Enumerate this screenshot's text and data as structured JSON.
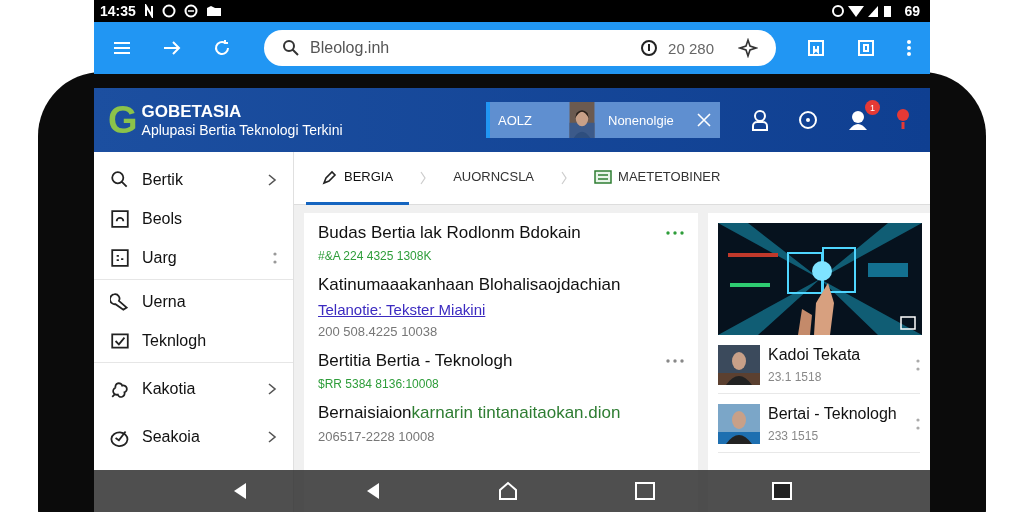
{
  "status_bar": {
    "time": "14:35",
    "battery": "69"
  },
  "toolbar": {
    "url": "Bleolog.inh",
    "counter": "20 280"
  },
  "app_header": {
    "logo_letter": "G",
    "title": "GOBETASIA",
    "subtitle": "Aplupasi Bertia Teknologi Terkini",
    "banner": {
      "label": "AOLZ",
      "text": "Nonenolgie"
    },
    "notification_count": "1"
  },
  "tabs": [
    {
      "label": "BERGIA",
      "selected": true
    },
    {
      "label": "AUORNCSLA",
      "selected": false
    },
    {
      "label": "MAETETOBINER",
      "selected": false
    }
  ],
  "sidebar": {
    "groups": [
      [
        {
          "label": "Bertik",
          "kind": "chevron"
        },
        {
          "label": "Beols",
          "kind": "plain"
        },
        {
          "label": "Uarg",
          "kind": "dots"
        }
      ],
      [
        {
          "label": "Uerna",
          "kind": "plain"
        },
        {
          "label": "Teknlogh",
          "kind": "plain"
        }
      ],
      [
        {
          "label": "Kakotia",
          "kind": "chevron"
        },
        {
          "label": "Seakoia",
          "kind": "chevron"
        }
      ]
    ]
  },
  "articles": [
    {
      "kind": "featured",
      "title": "Budas Bertia lak Rodlonm Bdokain",
      "meta": "#&A 224 4325 1308K"
    },
    {
      "kind": "plain",
      "title": "Katinumaaakanhaan Blohalisaojdachian",
      "link": "Telanotie: Tekster Miakini",
      "date": "200 508.4225 10038"
    },
    {
      "kind": "titled",
      "title": "Bertitia Bertia - Teknologh",
      "meta": "$RR 5384 8136:10008"
    },
    {
      "kind": "plain",
      "body_lead": "Bernaisiaion",
      "body_rest": "karnarin tintanaitaokan.dion",
      "date": "206517-2228 10008"
    }
  ],
  "side_list": [
    {
      "title": "Kadoi Tekata",
      "date": "23.1 1518"
    },
    {
      "title": "Bertai - Teknologh",
      "date": "233 1515"
    }
  ]
}
